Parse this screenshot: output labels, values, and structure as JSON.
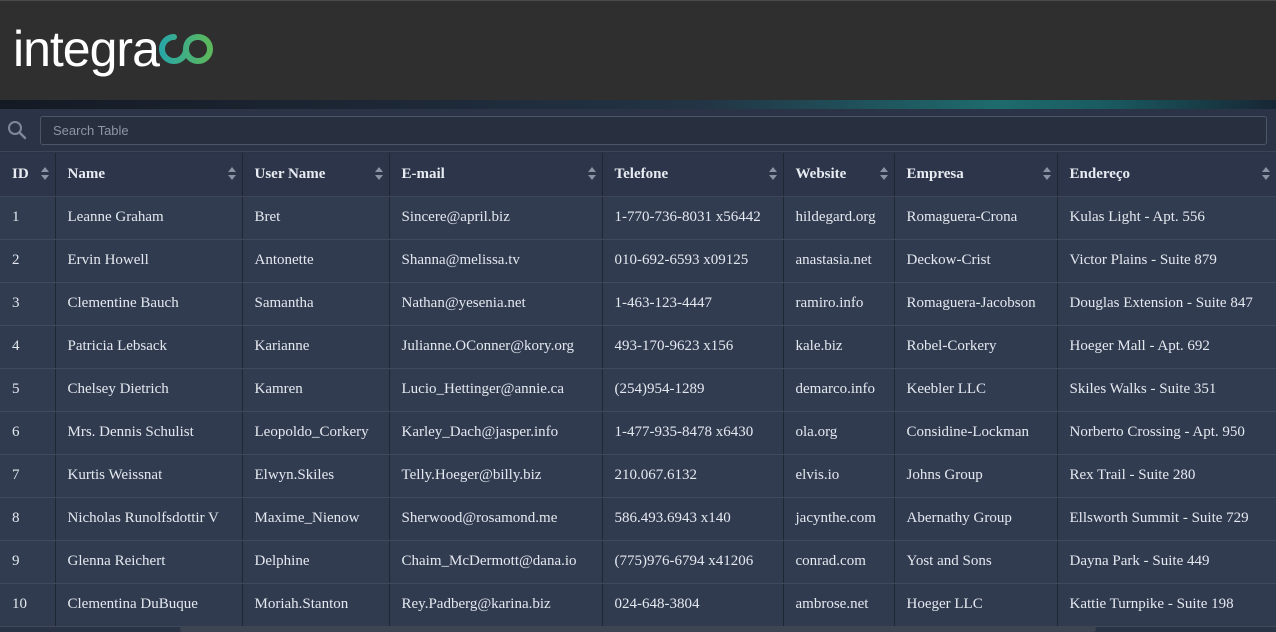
{
  "brand": {
    "logo_text": "integra",
    "logo_mark": "do",
    "logo_colors": [
      "#2aa7a4",
      "#5cb85c"
    ]
  },
  "search": {
    "placeholder": "Search Table",
    "value": ""
  },
  "table": {
    "columns": [
      "ID",
      "Name",
      "User Name",
      "E-mail",
      "Telefone",
      "Website",
      "Empresa",
      "Endereço"
    ],
    "rows": [
      [
        "1",
        "Leanne Graham",
        "Bret",
        "Sincere@april.biz",
        "1-770-736-8031 x56442",
        "hildegard.org",
        "Romaguera-Crona",
        "Kulas Light - Apt. 556"
      ],
      [
        "2",
        "Ervin Howell",
        "Antonette",
        "Shanna@melissa.tv",
        "010-692-6593 x09125",
        "anastasia.net",
        "Deckow-Crist",
        "Victor Plains - Suite 879"
      ],
      [
        "3",
        "Clementine Bauch",
        "Samantha",
        "Nathan@yesenia.net",
        "1-463-123-4447",
        "ramiro.info",
        "Romaguera-Jacobson",
        "Douglas Extension - Suite 847"
      ],
      [
        "4",
        "Patricia Lebsack",
        "Karianne",
        "Julianne.OConner@kory.org",
        "493-170-9623 x156",
        "kale.biz",
        "Robel-Corkery",
        "Hoeger Mall - Apt. 692"
      ],
      [
        "5",
        "Chelsey Dietrich",
        "Kamren",
        "Lucio_Hettinger@annie.ca",
        "(254)954-1289",
        "demarco.info",
        "Keebler LLC",
        "Skiles Walks - Suite 351"
      ],
      [
        "6",
        "Mrs. Dennis Schulist",
        "Leopoldo_Corkery",
        "Karley_Dach@jasper.info",
        "1-477-935-8478 x6430",
        "ola.org",
        "Considine-Lockman",
        "Norberto Crossing - Apt. 950"
      ],
      [
        "7",
        "Kurtis Weissnat",
        "Elwyn.Skiles",
        "Telly.Hoeger@billy.biz",
        "210.067.6132",
        "elvis.io",
        "Johns Group",
        "Rex Trail - Suite 280"
      ],
      [
        "8",
        "Nicholas Runolfsdottir V",
        "Maxime_Nienow",
        "Sherwood@rosamond.me",
        "586.493.6943 x140",
        "jacynthe.com",
        "Abernathy Group",
        "Ellsworth Summit - Suite 729"
      ],
      [
        "9",
        "Glenna Reichert",
        "Delphine",
        "Chaim_McDermott@dana.io",
        "(775)976-6794 x41206",
        "conrad.com",
        "Yost and Sons",
        "Dayna Park - Suite 449"
      ],
      [
        "10",
        "Clementina DuBuque",
        "Moriah.Stanton",
        "Rey.Padberg@karina.biz",
        "024-648-3804",
        "ambrose.net",
        "Hoeger LLC",
        "Kattie Turnpike - Suite 198"
      ]
    ]
  },
  "icons": {
    "search": "search-icon",
    "sort": "sort-icon"
  }
}
